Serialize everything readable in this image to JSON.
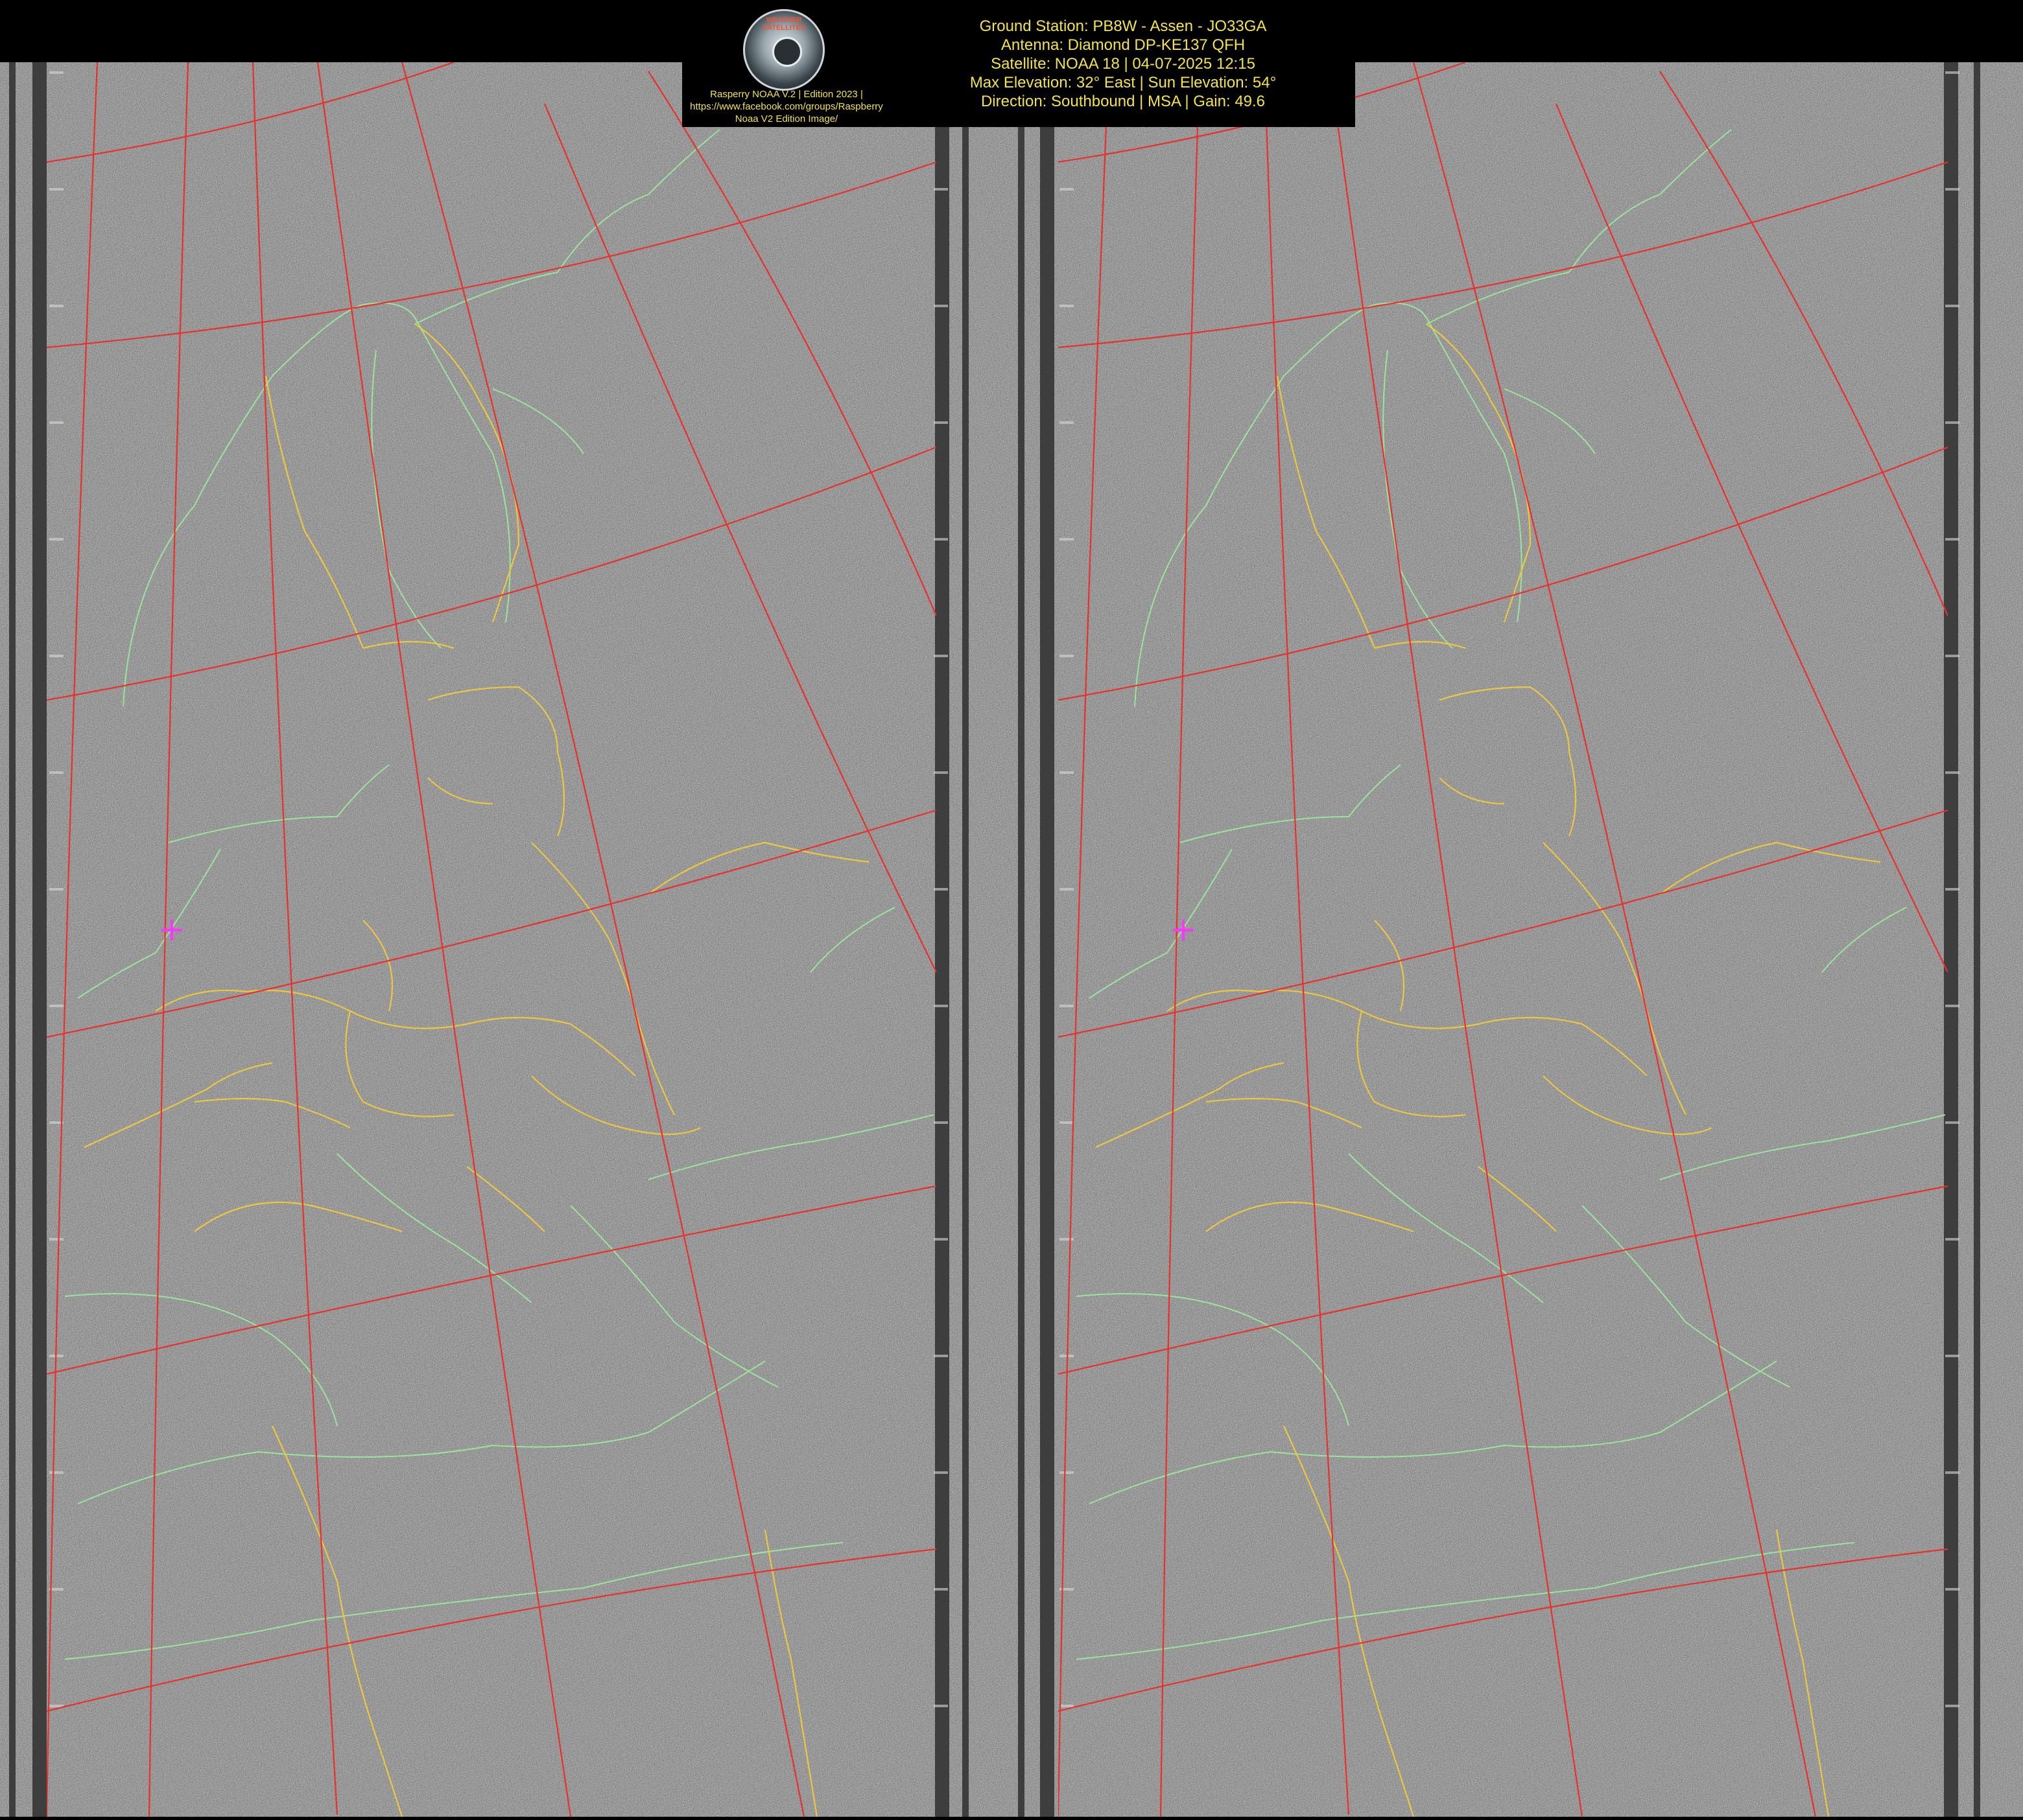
{
  "header": {
    "credits": [
      "Rasperry NOAA V.2 | Edition 2023 |",
      "https://www.facebook.com/groups/Raspberry",
      "Noaa V2 Edition Image/"
    ],
    "logo_text": "WEATHER SATELLITES",
    "info_lines": [
      "Ground Station: PB8W - Assen - JO33GA",
      "Antenna: Diamond DP-KE137 QFH",
      "Satellite: NOAA 18 | 04-07-2025 12:15",
      "Max Elevation: 32° East | Sun Elevation: 54°",
      "Direction: Southbound | MSA | Gain: 49.6"
    ]
  },
  "map": {
    "panels": [
      "left",
      "right"
    ],
    "colors": {
      "graticule": "#e8312c",
      "coastline": "#9be89b",
      "borders": "#f0c93a",
      "station_marker": "#ff33ff",
      "noise": "#8a8a8a",
      "sync_bars": "#2e2e2e"
    },
    "station_marker": "ground-station-crosshair"
  }
}
